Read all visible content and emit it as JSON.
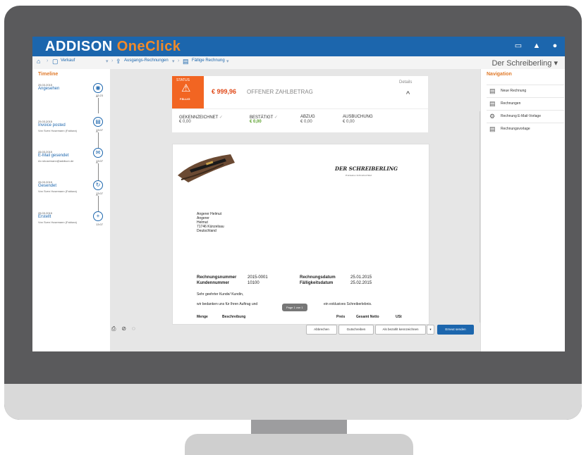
{
  "app": {
    "brand_a": "ADDISON",
    "brand_b": "OneClick",
    "account": "Der Schreiberling"
  },
  "breadcrumb": [
    {
      "label": "Verkauf",
      "icon": "cart-icon"
    },
    {
      "label": "Ausgangs-Rechnungen",
      "icon": "upload-icon"
    },
    {
      "label": "Fällige Rechnung",
      "icon": "document-icon"
    }
  ],
  "timeline": {
    "title": "Timeline",
    "events": [
      {
        "date": "25.03.2015",
        "title": "Angesehen",
        "subtitle": "",
        "time": "13:23",
        "icon": "eye-icon"
      },
      {
        "date": "25.03.2015",
        "title": "Invoice posted",
        "subtitle": "Von Sven Husemann (Faktura)",
        "time": "13:07",
        "icon": "document-icon"
      },
      {
        "date": "25.03.2015",
        "title": "E-Mail gesendet",
        "subtitle": "An shusemann@addison.de",
        "time": "13:07",
        "icon": "mail-icon"
      },
      {
        "date": "25.03.2015",
        "title": "Gesendet",
        "subtitle": "Von Sven Husemann (Faktura)",
        "time": "13:07",
        "icon": "refresh-icon"
      },
      {
        "date": "25.03.2015",
        "title": "Erstellt",
        "subtitle": "Von Sven Husemann (Faktura)",
        "time": "13:07",
        "icon": "plus-icon"
      }
    ]
  },
  "status": {
    "label": "STATUS",
    "due": "FÄLLIG",
    "amount": "€ 999,96",
    "amount_label": "OFFENER ZAHLBETRAG",
    "details": "Details",
    "accent": "#f26522"
  },
  "metrics": [
    {
      "label": "GEKENNZEICHNET",
      "value": "€ 0,00"
    },
    {
      "label": "BESTÄTIGT",
      "value": "€ 0,00"
    },
    {
      "label": "ABZUG",
      "value": "€ 0,00"
    },
    {
      "label": "AUSBUCHUNG",
      "value": "€ 0,00"
    }
  ],
  "document": {
    "company": "DER SCHREIBERLING",
    "company_sub": "Exklusive Schreibartikel",
    "address": [
      "Angerer Helmut",
      "Angerer",
      "Helmut",
      "71746 Künzelsau",
      "Deutschland"
    ],
    "invoice_no_label": "Rechnungsnummer",
    "invoice_no": "2015-0001",
    "customer_no_label": "Kundennummer",
    "customer_no": "10100",
    "invoice_date_label": "Rechnungsdatum",
    "invoice_date": "25.01.2015",
    "due_date_label": "Fälligkeitsdatum",
    "due_date": "25.02.2015",
    "greeting": "Sehr geehrter Kunde/ Kundin,",
    "body_a": "wir bedanken uns für Ihren Auftrag und",
    "body_b": "ein exklusives Schreiberlebnis.",
    "columns": [
      "Menge",
      "Beschreibung",
      "Preis",
      "Gesamt Netto",
      "USt"
    ],
    "page_indicator": "Page 1 von 1"
  },
  "actions": {
    "cancel": "Abbrechen",
    "credit": "Gutschreiben",
    "mark_paid": "Als bezahlt kennzeichnen",
    "dropdown": "▾",
    "resend": "Erneut senden"
  },
  "navigation": {
    "title": "Navigation",
    "items": [
      {
        "label": "Neue Rechnung",
        "icon": "new-document-icon"
      },
      {
        "label": "Rechnungen",
        "icon": "document-icon"
      },
      {
        "label": "Rechnung E-Mail-Vorlage",
        "icon": "email-template-icon"
      },
      {
        "label": "Rechnungsvorlage",
        "icon": "template-icon"
      }
    ]
  }
}
